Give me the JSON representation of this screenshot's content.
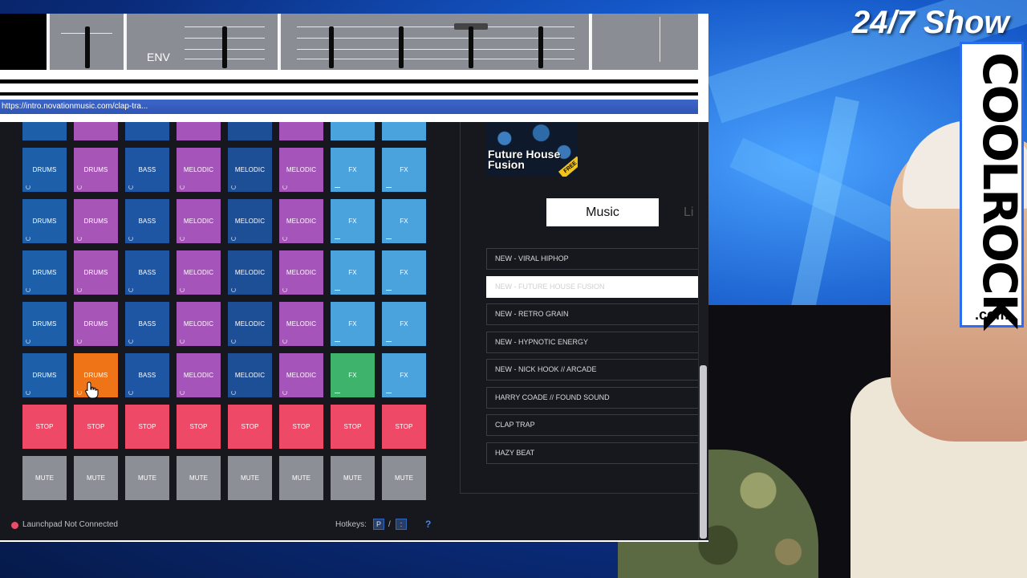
{
  "overlay": {
    "show_title": "24/7 Show",
    "brand_name": "COOLROCK",
    "brand_suffix": ".com"
  },
  "mixer": {
    "env_label": "ENV"
  },
  "browser": {
    "status_url": "https://intro.novationmusic.com/clap-tra..."
  },
  "pads": {
    "rows": [
      [
        "DRUMS",
        "DRUMS",
        "BASS",
        "MELODIC",
        "MELODIC",
        "MELODIC",
        "FX",
        "FX"
      ],
      [
        "DRUMS",
        "DRUMS",
        "BASS",
        "MELODIC",
        "MELODIC",
        "MELODIC",
        "FX",
        "FX"
      ],
      [
        "DRUMS",
        "DRUMS",
        "BASS",
        "MELODIC",
        "MELODIC",
        "MELODIC",
        "FX",
        "FX"
      ],
      [
        "DRUMS",
        "DRUMS",
        "BASS",
        "MELODIC",
        "MELODIC",
        "MELODIC",
        "FX",
        "FX"
      ],
      [
        "DRUMS",
        "DRUMS",
        "BASS",
        "MELODIC",
        "MELODIC",
        "MELODIC",
        "FX",
        "FX"
      ]
    ],
    "stop_label": "STOP",
    "mute_label": "MUTE",
    "colors": {
      "drums_blue": "#1d5fa9",
      "drums_purple": "#a855b8",
      "bass": "#1f56a3",
      "melodic_purple": "#a555b9",
      "melodic_blue": "#1d4f96",
      "fx": "#4ba3dd",
      "active_orange": "#ee7417",
      "active_green": "#3db36b",
      "stop": "#ee4a68",
      "mute": "#8d8f96"
    }
  },
  "pack": {
    "title": "Future House Fusion",
    "badge": "FREE"
  },
  "tabs": {
    "music": "Music",
    "next_partial": "Li"
  },
  "pack_list": [
    "NEW - VIRAL HIPHOP",
    "NEW - FUTURE HOUSE FUSION",
    "NEW - RETRO GRAIN",
    "NEW - HYPNOTIC ENERGY",
    "NEW - NICK HOOK // ARCADE",
    "HARRY COADE // FOUND SOUND",
    "CLAP TRAP",
    "HAZY BEAT"
  ],
  "footer": {
    "status": "Launchpad Not Connected",
    "hotkeys_label": "Hotkeys:",
    "hotkey_1": "P",
    "hotkey_separator": "/",
    "hotkey_2": ":",
    "help": "?"
  }
}
